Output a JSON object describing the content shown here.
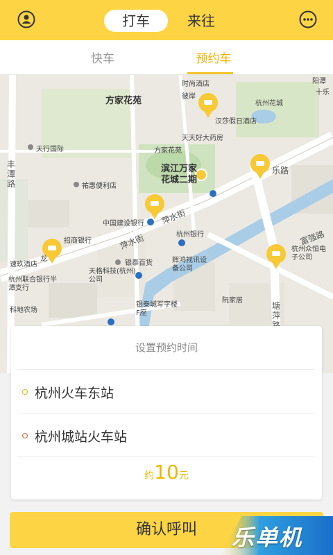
{
  "header": {
    "mode_tabs": [
      {
        "label": "打车",
        "active": true
      },
      {
        "label": "来往",
        "active": false
      }
    ],
    "left_icon": "user-icon",
    "right_icon": "chat-icon"
  },
  "subtabs": [
    {
      "label": "快车",
      "active": false
    },
    {
      "label": "预约车",
      "active": true
    }
  ],
  "map": {
    "labels": [
      "方家花苑",
      "时尚酒店",
      "彼岸",
      "汉莎假日酒店",
      "杭州花城",
      "阳潭",
      "十乐",
      "天天好大药房",
      "方家花苑",
      "天行国际",
      "丰潭路",
      "滨江万家",
      "花城二期",
      "祐惠便利店",
      "乐路",
      "中国建设银行",
      "萍水街",
      "萍水街",
      "杭州银行",
      "招商银行",
      "龙",
      "速玖酒店",
      "杭州联合银行半潭支行",
      "天格科技(杭州)公司",
      "银泰百货",
      "辉鸿视讯设备公司",
      "富强路",
      "杭州众恒电子公司",
      "科地农场",
      "银泰城写字楼F座",
      "阮家居",
      "塘萍路"
    ],
    "road_labels": []
  },
  "panel": {
    "set_time_label": "设置预约时间",
    "from": "杭州火车东站",
    "to": "杭州城站火车站",
    "price_prefix": "约",
    "price_value": "10",
    "price_unit": "元"
  },
  "confirm_label": "确认呼叫",
  "watermark": "乐单机",
  "colors": {
    "brand_yellow": "#fdd544",
    "accent": "#f0b500",
    "origin_dot": "#f3b600",
    "destination_dot": "#e05a3a"
  }
}
